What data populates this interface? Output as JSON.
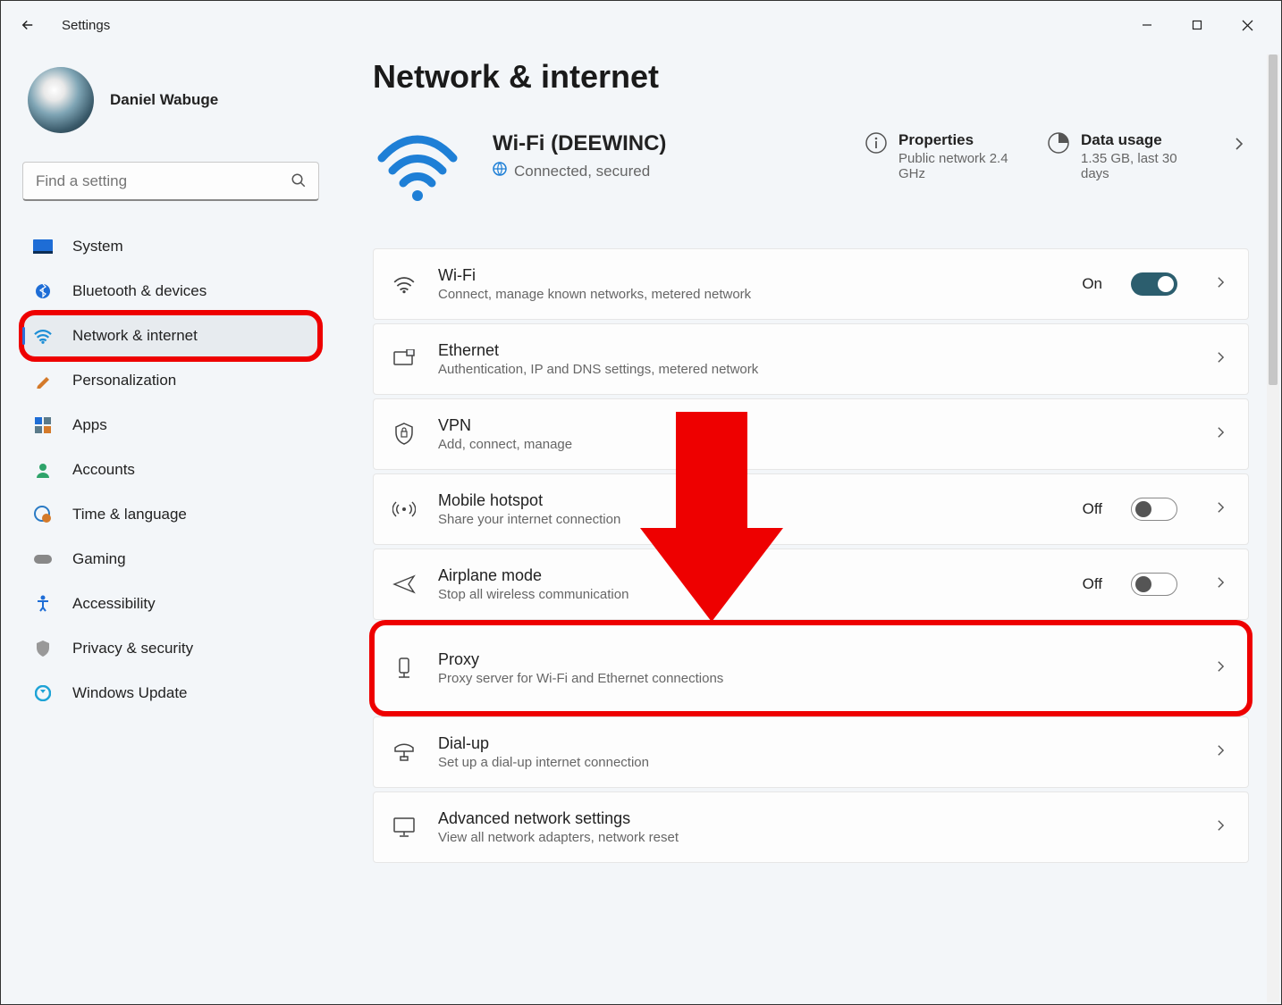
{
  "app": {
    "title": "Settings"
  },
  "user": {
    "name": "Daniel Wabuge"
  },
  "search": {
    "placeholder": "Find a setting"
  },
  "sidebar": {
    "items": [
      {
        "label": "System"
      },
      {
        "label": "Bluetooth & devices"
      },
      {
        "label": "Network & internet"
      },
      {
        "label": "Personalization"
      },
      {
        "label": "Apps"
      },
      {
        "label": "Accounts"
      },
      {
        "label": "Time & language"
      },
      {
        "label": "Gaming"
      },
      {
        "label": "Accessibility"
      },
      {
        "label": "Privacy & security"
      },
      {
        "label": "Windows Update"
      }
    ],
    "active_index": 2
  },
  "page": {
    "title": "Network & internet"
  },
  "hero": {
    "ssid": "Wi-Fi (DEEWINC)",
    "status": "Connected, secured",
    "properties": {
      "label": "Properties",
      "sub": "Public network 2.4 GHz"
    },
    "usage": {
      "label": "Data usage",
      "sub": "1.35 GB, last 30 days"
    }
  },
  "cards": [
    {
      "title": "Wi-Fi",
      "sub": "Connect, manage known networks, metered network",
      "toggle": "On"
    },
    {
      "title": "Ethernet",
      "sub": "Authentication, IP and DNS settings, metered network"
    },
    {
      "title": "VPN",
      "sub": "Add, connect, manage"
    },
    {
      "title": "Mobile hotspot",
      "sub": "Share your internet connection",
      "toggle": "Off"
    },
    {
      "title": "Airplane mode",
      "sub": "Stop all wireless communication",
      "toggle": "Off"
    },
    {
      "title": "Proxy",
      "sub": "Proxy server for Wi-Fi and Ethernet connections"
    },
    {
      "title": "Dial-up",
      "sub": "Set up a dial-up internet connection"
    },
    {
      "title": "Advanced network settings",
      "sub": "View all network adapters, network reset"
    }
  ]
}
